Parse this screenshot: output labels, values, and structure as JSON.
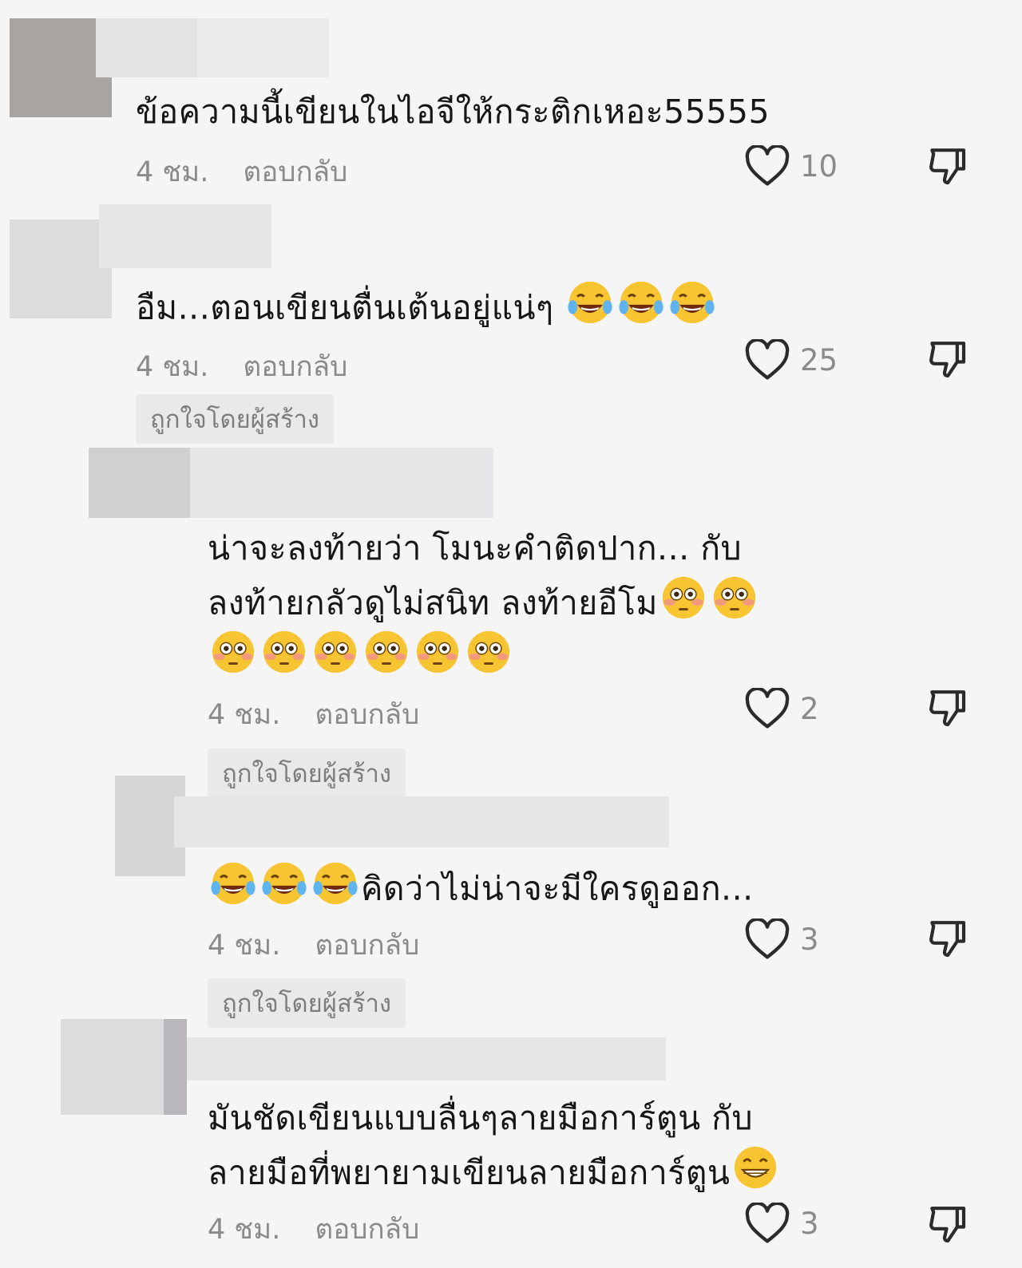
{
  "comments": [
    {
      "text": "ข้อความนี้เขียนในไอจีให้กระติกเหอะ55555",
      "time": "4 ชม.",
      "reply": "ตอบกลับ",
      "likes": "10"
    },
    {
      "text": "อืม...ตอนเขียนตื่นเต้นอยู่แน่ๆ",
      "emoji": "face-with-tears-of-joy",
      "time": "4 ชม.",
      "reply": "ตอบกลับ",
      "likes": "25",
      "badge": "ถูกใจโดยผู้สร้าง"
    },
    {
      "line1": "น่าจะลงท้ายว่า โมนะคำติดปาก... กับ",
      "line2": "ลงท้ายกลัวดูไม่สนิท  ลงท้ายอีโม",
      "emoji": "flushed-face",
      "time": "4 ชม.",
      "reply": "ตอบกลับ",
      "likes": "2",
      "badge": "ถูกใจโดยผู้สร้าง"
    },
    {
      "text": "คิดว่าไม่น่าจะมีใครดูออก...",
      "emoji": "face-with-tears-of-joy",
      "time": "4 ชม.",
      "reply": "ตอบกลับ",
      "likes": "3",
      "badge": "ถูกใจโดยผู้สร้าง"
    },
    {
      "line1": "มันชัดเขียนแบบลื่นๆลายมือการ์ตูน  กับ",
      "line2": "ลายมือที่พยายามเขียนลายมือการ์ตูน",
      "emoji": "grinning-face",
      "time": "4 ชม.",
      "reply": "ตอบกลับ",
      "likes": "3"
    }
  ],
  "icons": {
    "like": "heart-outline-icon",
    "dislike": "thumbs-down-icon"
  },
  "colors": {
    "background": "#f5f5f5",
    "meta_text": "#8a8a8a",
    "badge_bg": "#e9e9e9"
  }
}
